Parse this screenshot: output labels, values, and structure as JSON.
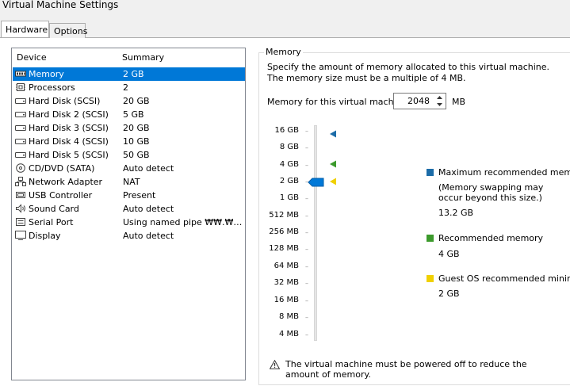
{
  "window": {
    "title": "Virtual Machine Settings"
  },
  "tabs": [
    {
      "label": "Hardware",
      "active": true
    },
    {
      "label": "Options",
      "active": false
    }
  ],
  "device_list": {
    "headers": {
      "device": "Device",
      "summary": "Summary"
    },
    "rows": [
      {
        "icon": "memory-icon",
        "device": "Memory",
        "summary": "2 GB",
        "selected": true
      },
      {
        "icon": "processor-icon",
        "device": "Processors",
        "summary": "2"
      },
      {
        "icon": "hard-disk-icon",
        "device": "Hard Disk (SCSI)",
        "summary": "20 GB"
      },
      {
        "icon": "hard-disk-icon",
        "device": "Hard Disk 2 (SCSI)",
        "summary": "5 GB"
      },
      {
        "icon": "hard-disk-icon",
        "device": "Hard Disk 3 (SCSI)",
        "summary": "20 GB"
      },
      {
        "icon": "hard-disk-icon",
        "device": "Hard Disk 4 (SCSI)",
        "summary": "10 GB"
      },
      {
        "icon": "hard-disk-icon",
        "device": "Hard Disk 5 (SCSI)",
        "summary": "50 GB"
      },
      {
        "icon": "cd-dvd-icon",
        "device": "CD/DVD (SATA)",
        "summary": "Auto detect"
      },
      {
        "icon": "network-adapter-icon",
        "device": "Network Adapter",
        "summary": "NAT"
      },
      {
        "icon": "usb-icon",
        "device": "USB Controller",
        "summary": "Present"
      },
      {
        "icon": "sound-icon",
        "device": "Sound Card",
        "summary": "Auto detect"
      },
      {
        "icon": "serial-port-icon",
        "device": "Serial Port",
        "summary": "Using named pipe ₩₩.₩pipe..."
      },
      {
        "icon": "display-icon",
        "device": "Display",
        "summary": "Auto detect"
      }
    ]
  },
  "memory": {
    "group_title": "Memory",
    "description": "Specify the amount of memory allocated to this virtual machine. The memory size must be a multiple of 4 MB.",
    "field_label": "Memory for this virtual machine:",
    "value": "2048",
    "unit": "MB",
    "slider_ticks": [
      "16 GB",
      "8 GB",
      "4 GB",
      "2 GB",
      "1 GB",
      "512 MB",
      "256 MB",
      "128 MB",
      "64 MB",
      "32 MB",
      "16 MB",
      "8 MB",
      "4 MB"
    ],
    "current_value": "2 GB",
    "legend": [
      {
        "name": "Maximum recommended memory",
        "note": "(Memory swapping may occur beyond this size.)",
        "value": "13.2 GB",
        "color": "#1c6ca8"
      },
      {
        "name": "Recommended memory",
        "value": "4 GB",
        "color": "#3c9a2c"
      },
      {
        "name": "Guest OS recommended minimum",
        "value": "2 GB",
        "color": "#f0d000"
      }
    ],
    "warning": "The virtual machine must be powered off to reduce the amount of memory."
  }
}
